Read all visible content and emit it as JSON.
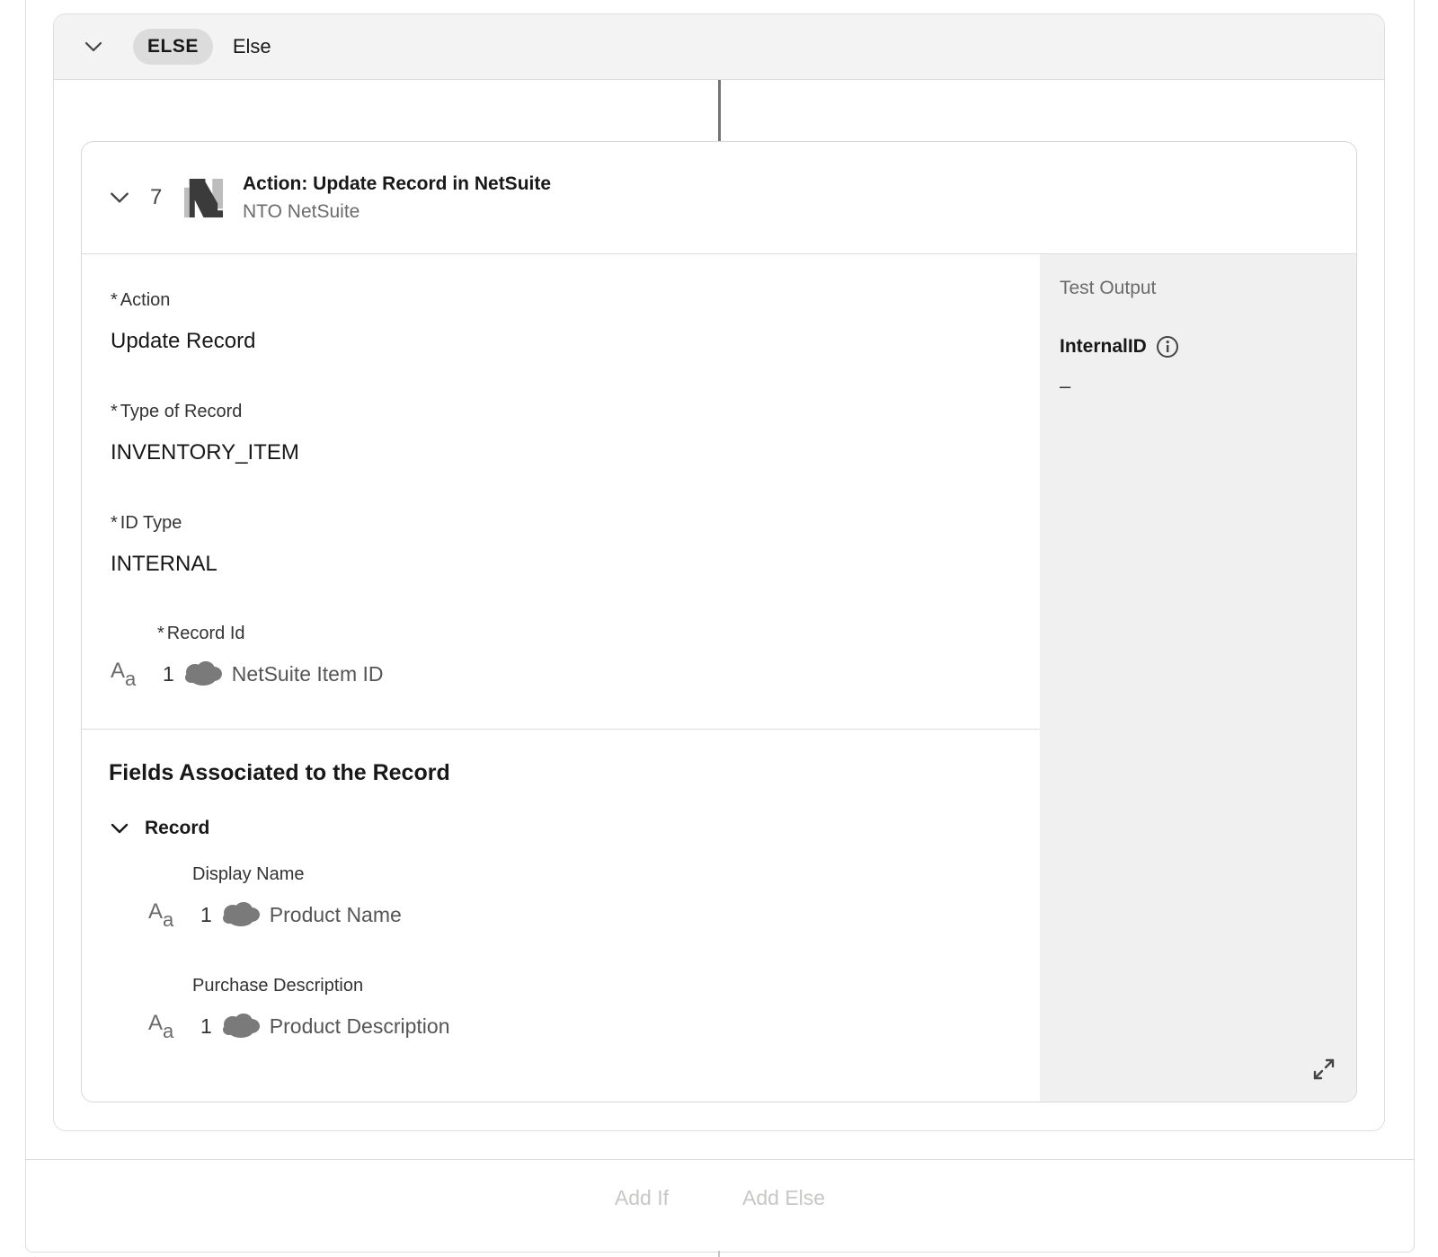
{
  "footer": {
    "add_if_label": "Add If",
    "add_else_label": "Add Else"
  },
  "else_branch": {
    "badge": "ELSE",
    "title": "Else"
  },
  "action": {
    "step_number": "7",
    "title": "Action: Update Record in NetSuite",
    "subtitle": "NTO NetSuite",
    "fields": {
      "action": {
        "required": "*",
        "label": "Action",
        "value": "Update Record"
      },
      "type_of_record": {
        "required": "*",
        "label": "Type of Record",
        "value": "INVENTORY_ITEM"
      },
      "id_type": {
        "required": "*",
        "label": "ID Type",
        "value": "INTERNAL"
      },
      "record_id": {
        "required": "*",
        "label": "Record Id",
        "step": "1",
        "source_label": "NetSuite Item ID"
      }
    },
    "associated_section": {
      "title": "Fields Associated to the Record",
      "group_label": "Record",
      "items": [
        {
          "label": "Display Name",
          "step": "1",
          "source_label": "Product Name"
        },
        {
          "label": "Purchase Description",
          "step": "1",
          "source_label": "Product Description"
        }
      ]
    }
  },
  "test_output": {
    "title": "Test Output",
    "field_label": "InternalID",
    "field_value": "–"
  },
  "icons": {
    "collapse": "chevron-down-icon",
    "text_type": "text-type-icon",
    "salesforce": "salesforce-cloud-icon",
    "info": "info-icon",
    "expand": "expand-icon",
    "netsuite": "netsuite-logo"
  }
}
